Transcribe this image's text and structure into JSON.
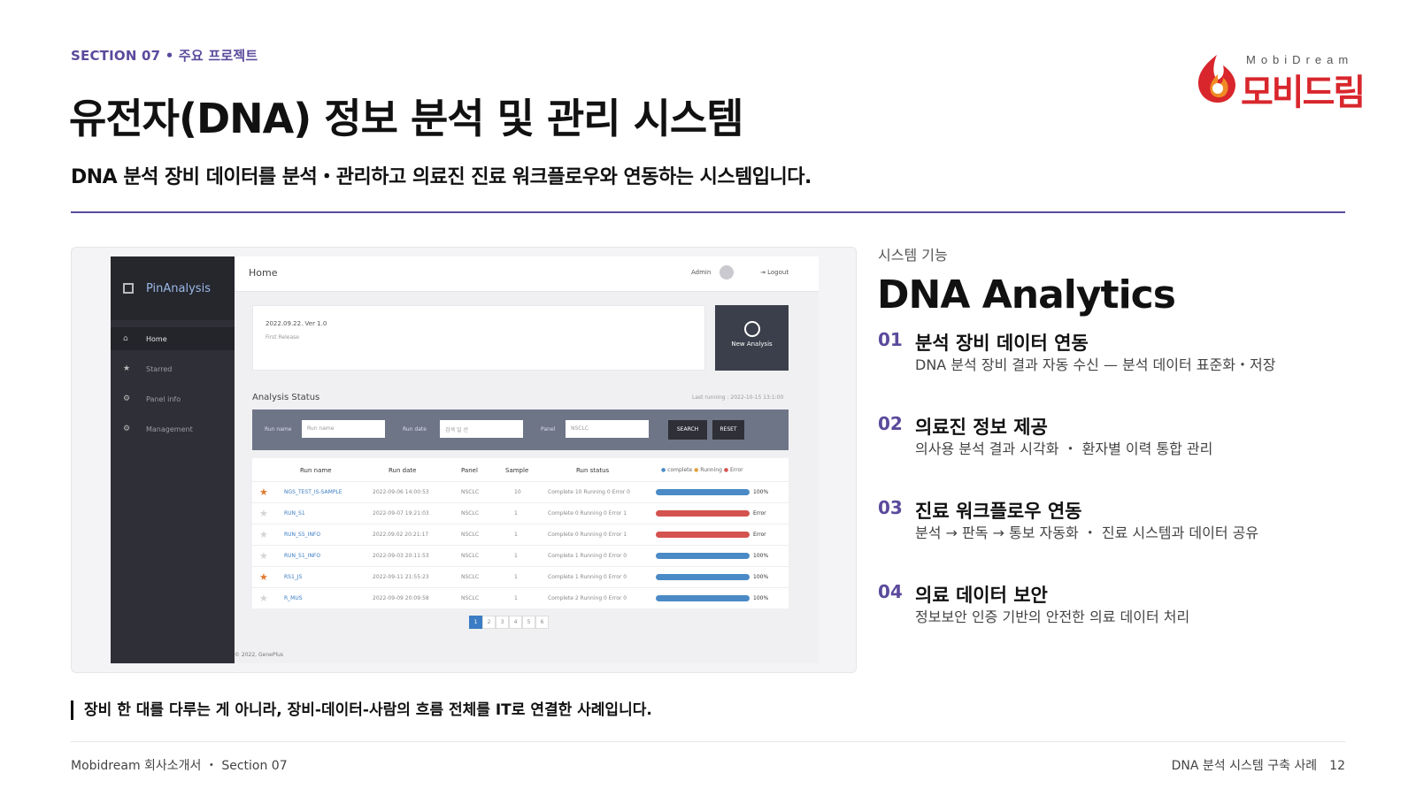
{
  "header": {
    "section_label": "SECTION 07 • 주요 프로젝트",
    "title": "유전자(DNA) 정보 분석 및 관리 시스템",
    "subtitle": "DNA 분석 장비 데이터를 분석・관리하고 의료진 진료 워크플로우와 연동하는 시스템입니다."
  },
  "logo": {
    "small": "MobiDream",
    "big": "모비드림",
    "colors": {
      "red": "#d8262c",
      "orange": "#f08a24"
    }
  },
  "screenshot": {
    "brand": "PinAnalysis",
    "sidebar": [
      {
        "icon": "home-icon",
        "label": "Home",
        "active": true
      },
      {
        "icon": "star-icon",
        "label": "Starred",
        "active": false
      },
      {
        "icon": "gear-icon",
        "label": "Panel info",
        "active": false
      },
      {
        "icon": "gear-icon",
        "label": "Management",
        "active": false
      }
    ],
    "topbar": {
      "home": "Home",
      "admin": "Admin",
      "logout": "Logout"
    },
    "info_card": {
      "date": "2022.09.22. Ver 1.0",
      "note": "First Release"
    },
    "new_analysis": "New Analysis",
    "status_title": "Analysis Status",
    "status_last": "Last running : 2022-10-15 13:1:00",
    "filters": {
      "run_name_label": "Run name",
      "run_name_placeholder": "Run name",
      "run_date_label": "Run date",
      "run_date_value": "검색 일 선",
      "panel_label": "Panel",
      "panel_value": "NSCLC",
      "search": "SEARCH",
      "reset": "RESET"
    },
    "table": {
      "headers": [
        "Run name",
        "Run date",
        "Panel",
        "Sample",
        "Run status"
      ],
      "legend": [
        "complete",
        "Running",
        "Error"
      ],
      "rows": [
        {
          "starred": true,
          "name": "NGS_TEST_IS-SAMPLE",
          "date": "2022-09-06 14:00:53",
          "panel": "NSCLC",
          "sample": "10",
          "status": "Complete 10 Running 0 Error 0",
          "pct": "100%",
          "state": "complete"
        },
        {
          "starred": false,
          "name": "RUN_S1",
          "date": "2022-09-07 19:21:03",
          "panel": "NSCLC",
          "sample": "1",
          "status": "Complete 0 Running 0 Error 1",
          "pct": "Error",
          "state": "error"
        },
        {
          "starred": false,
          "name": "RUN_S5_INFO",
          "date": "2022.09.02 20:21:17",
          "panel": "NSCLC",
          "sample": "1",
          "status": "Complete 0 Running 0 Error 1",
          "pct": "Error",
          "state": "error"
        },
        {
          "starred": false,
          "name": "RUN_S1_INFO",
          "date": "2022-09-03 20:11:53",
          "panel": "NSCLC",
          "sample": "1",
          "status": "Complete 1 Running 0 Error 0",
          "pct": "100%",
          "state": "complete"
        },
        {
          "starred": true,
          "name": "RS1_JS",
          "date": "2022-09-11 21:55:23",
          "panel": "NSCLC",
          "sample": "1",
          "status": "Complete 1 Running 0 Error 0",
          "pct": "100%",
          "state": "complete"
        },
        {
          "starred": false,
          "name": "R_MUS",
          "date": "2022-09-09 20:09:58",
          "panel": "NSCLC",
          "sample": "1",
          "status": "Complete 2 Running 0 Error 0",
          "pct": "100%",
          "state": "complete"
        }
      ]
    },
    "pages": [
      "1",
      "2",
      "3",
      "4",
      "5",
      "6"
    ],
    "copyright": "© 2022, GenePlus",
    "colors": {
      "complete": "#4a8ac6",
      "error": "#d4524f",
      "running": "#e0a43a"
    }
  },
  "features": {
    "eyebrow": "시스템 기능",
    "title": "DNA Analytics",
    "items": [
      {
        "num": "01",
        "title": "분석 장비 데이터 연동",
        "desc": "DNA 분석 장비 결과 자동 수신 — 분석 데이터 표준화・저장"
      },
      {
        "num": "02",
        "title": "의료진 정보 제공",
        "desc": "의사용 분석 결과 시각화 ・ 환자별 이력 통합 관리"
      },
      {
        "num": "03",
        "title": "진료 워크플로우 연동",
        "desc": "분석 → 판독 → 통보 자동화 ・ 진료 시스템과 데이터 공유"
      },
      {
        "num": "04",
        "title": "의료 데이터 보안",
        "desc": "정보보안 인증 기반의 안전한 의료 데이터 처리"
      }
    ]
  },
  "quote": "장비 한 대를 다루는 게 아니라, 장비-데이터-사람의 흐름 전체를 IT로 연결한 사례입니다.",
  "footer": {
    "left": "Mobidream 회사소개서 ・ Section 07",
    "right": "DNA 분석 시스템 구축 사례",
    "page": "12"
  }
}
